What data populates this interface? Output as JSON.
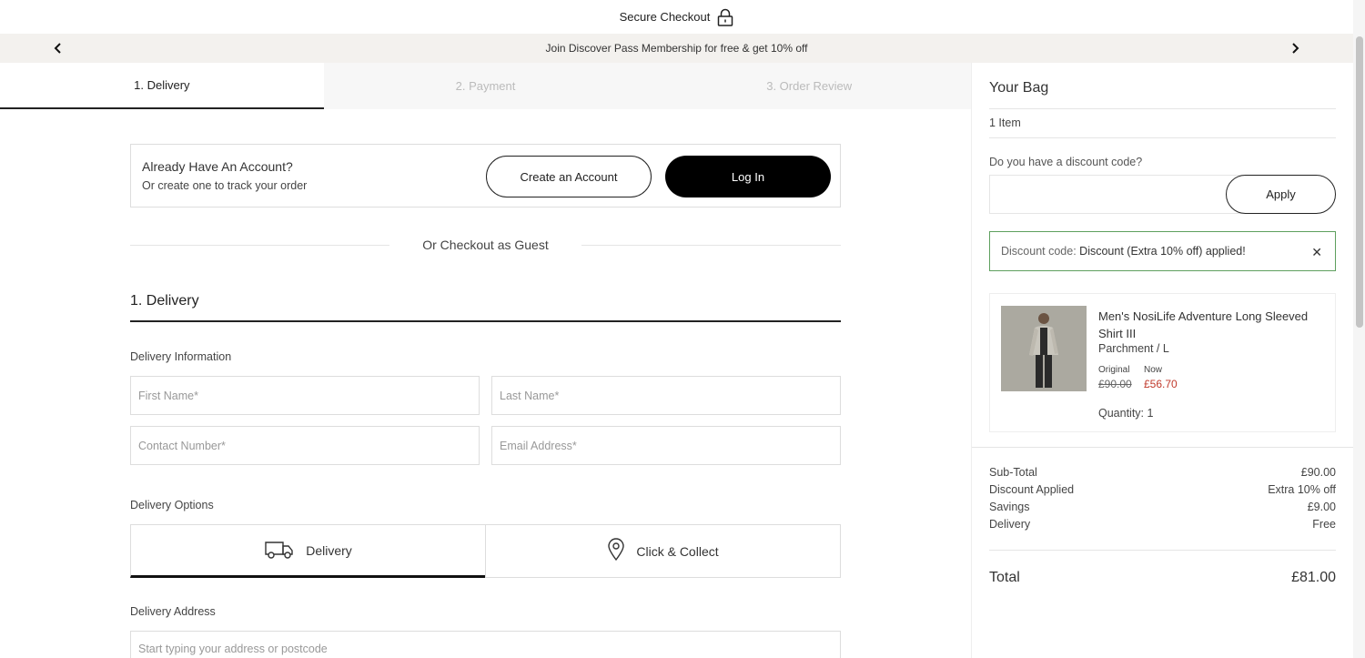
{
  "header": {
    "title": "Secure Checkout"
  },
  "promo": {
    "text": "Join Discover Pass Membership for free & get 10% off"
  },
  "steps": [
    {
      "label": "1. Delivery"
    },
    {
      "label": "2. Payment"
    },
    {
      "label": "3. Order Review"
    }
  ],
  "account": {
    "title": "Already Have An Account?",
    "subtitle": "Or create one to track your order",
    "create_label": "Create an Account",
    "login_label": "Log In"
  },
  "guest": {
    "text": "Or Checkout as Guest"
  },
  "delivery": {
    "section_title": "1. Delivery",
    "info_label": "Delivery Information",
    "first_name_placeholder": "First Name*",
    "last_name_placeholder": "Last Name*",
    "contact_placeholder": "Contact Number*",
    "email_placeholder": "Email Address*",
    "options_label": "Delivery Options",
    "option_delivery": "Delivery",
    "option_collect": "Click & Collect",
    "address_label": "Delivery Address",
    "address_placeholder": "Start typing your address or postcode"
  },
  "bag": {
    "title": "Your Bag",
    "items_count": "1 Item",
    "discount_question": "Do you have a discount code?",
    "discount_value": "",
    "apply_label": "Apply",
    "applied_prefix": "Discount code:",
    "applied_code": "Discount (Extra 10% off)",
    "applied_suffix": "applied!",
    "product": {
      "name": "Men's NosiLife Adventure Long Sleeved Shirt III",
      "variant": "Parchment / L",
      "original_label": "Original",
      "now_label": "Now",
      "original_price": "£90.00",
      "now_price": "£56.70",
      "quantity": "Quantity: 1"
    },
    "summary": {
      "subtotal_label": "Sub-Total",
      "subtotal_value": "£90.00",
      "discount_label": "Discount Applied",
      "discount_value": "Extra 10% off",
      "savings_label": "Savings",
      "savings_value": "£9.00",
      "delivery_label": "Delivery",
      "delivery_value": "Free",
      "total_label": "Total",
      "total_value": "£81.00"
    }
  },
  "colors": {
    "accent": "#000000",
    "sale": "#c0392b",
    "success_border": "#5ea05e",
    "promo_bg": "#f3f1ee"
  },
  "icons": [
    "lock-icon",
    "chevron-left-icon",
    "chevron-right-icon",
    "truck-icon",
    "location-pin-icon",
    "close-icon"
  ]
}
